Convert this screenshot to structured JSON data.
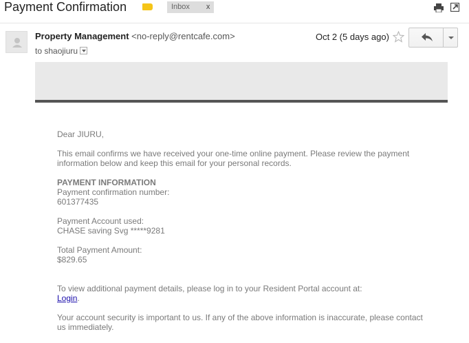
{
  "email": {
    "subject": "Payment Confirmation",
    "label_chip": "Inbox",
    "label_chip_close": "x",
    "sender_name": "Property Management",
    "sender_email": "<no-reply@rentcafe.com>",
    "to_text": "to shaojiuru",
    "date": "Oct 2 (5 days ago)"
  },
  "message": {
    "greeting": "Dear JIURU,",
    "intro": "This email confirms we have received your one-time online payment. Please review the payment information below and keep this email for your personal records.",
    "section_title": "PAYMENT INFORMATION",
    "conf_label": "Payment confirmation number:",
    "conf_value": "601377435",
    "account_label": "Payment Account used:",
    "account_value": "CHASE saving Svg *****9281",
    "total_label": "Total Payment Amount:",
    "total_value": "$829.65",
    "portal_text": "To view additional payment details, please log in to your Resident Portal account at:",
    "login_link": "Login",
    "login_suffix": ".",
    "security_text": "Your account security is important to us. If any of the above information is inaccurate, please contact us immediately."
  },
  "icons": {
    "label": "label-tag-icon",
    "print": "print-icon",
    "popout": "new-window-icon",
    "star": "star-icon",
    "reply": "reply-icon",
    "more": "chevron-down-icon"
  },
  "colors": {
    "label_tag": "#f5c518",
    "link": "#1a0dab",
    "banner": "#e9e9e9",
    "banner_rule": "#555555"
  }
}
